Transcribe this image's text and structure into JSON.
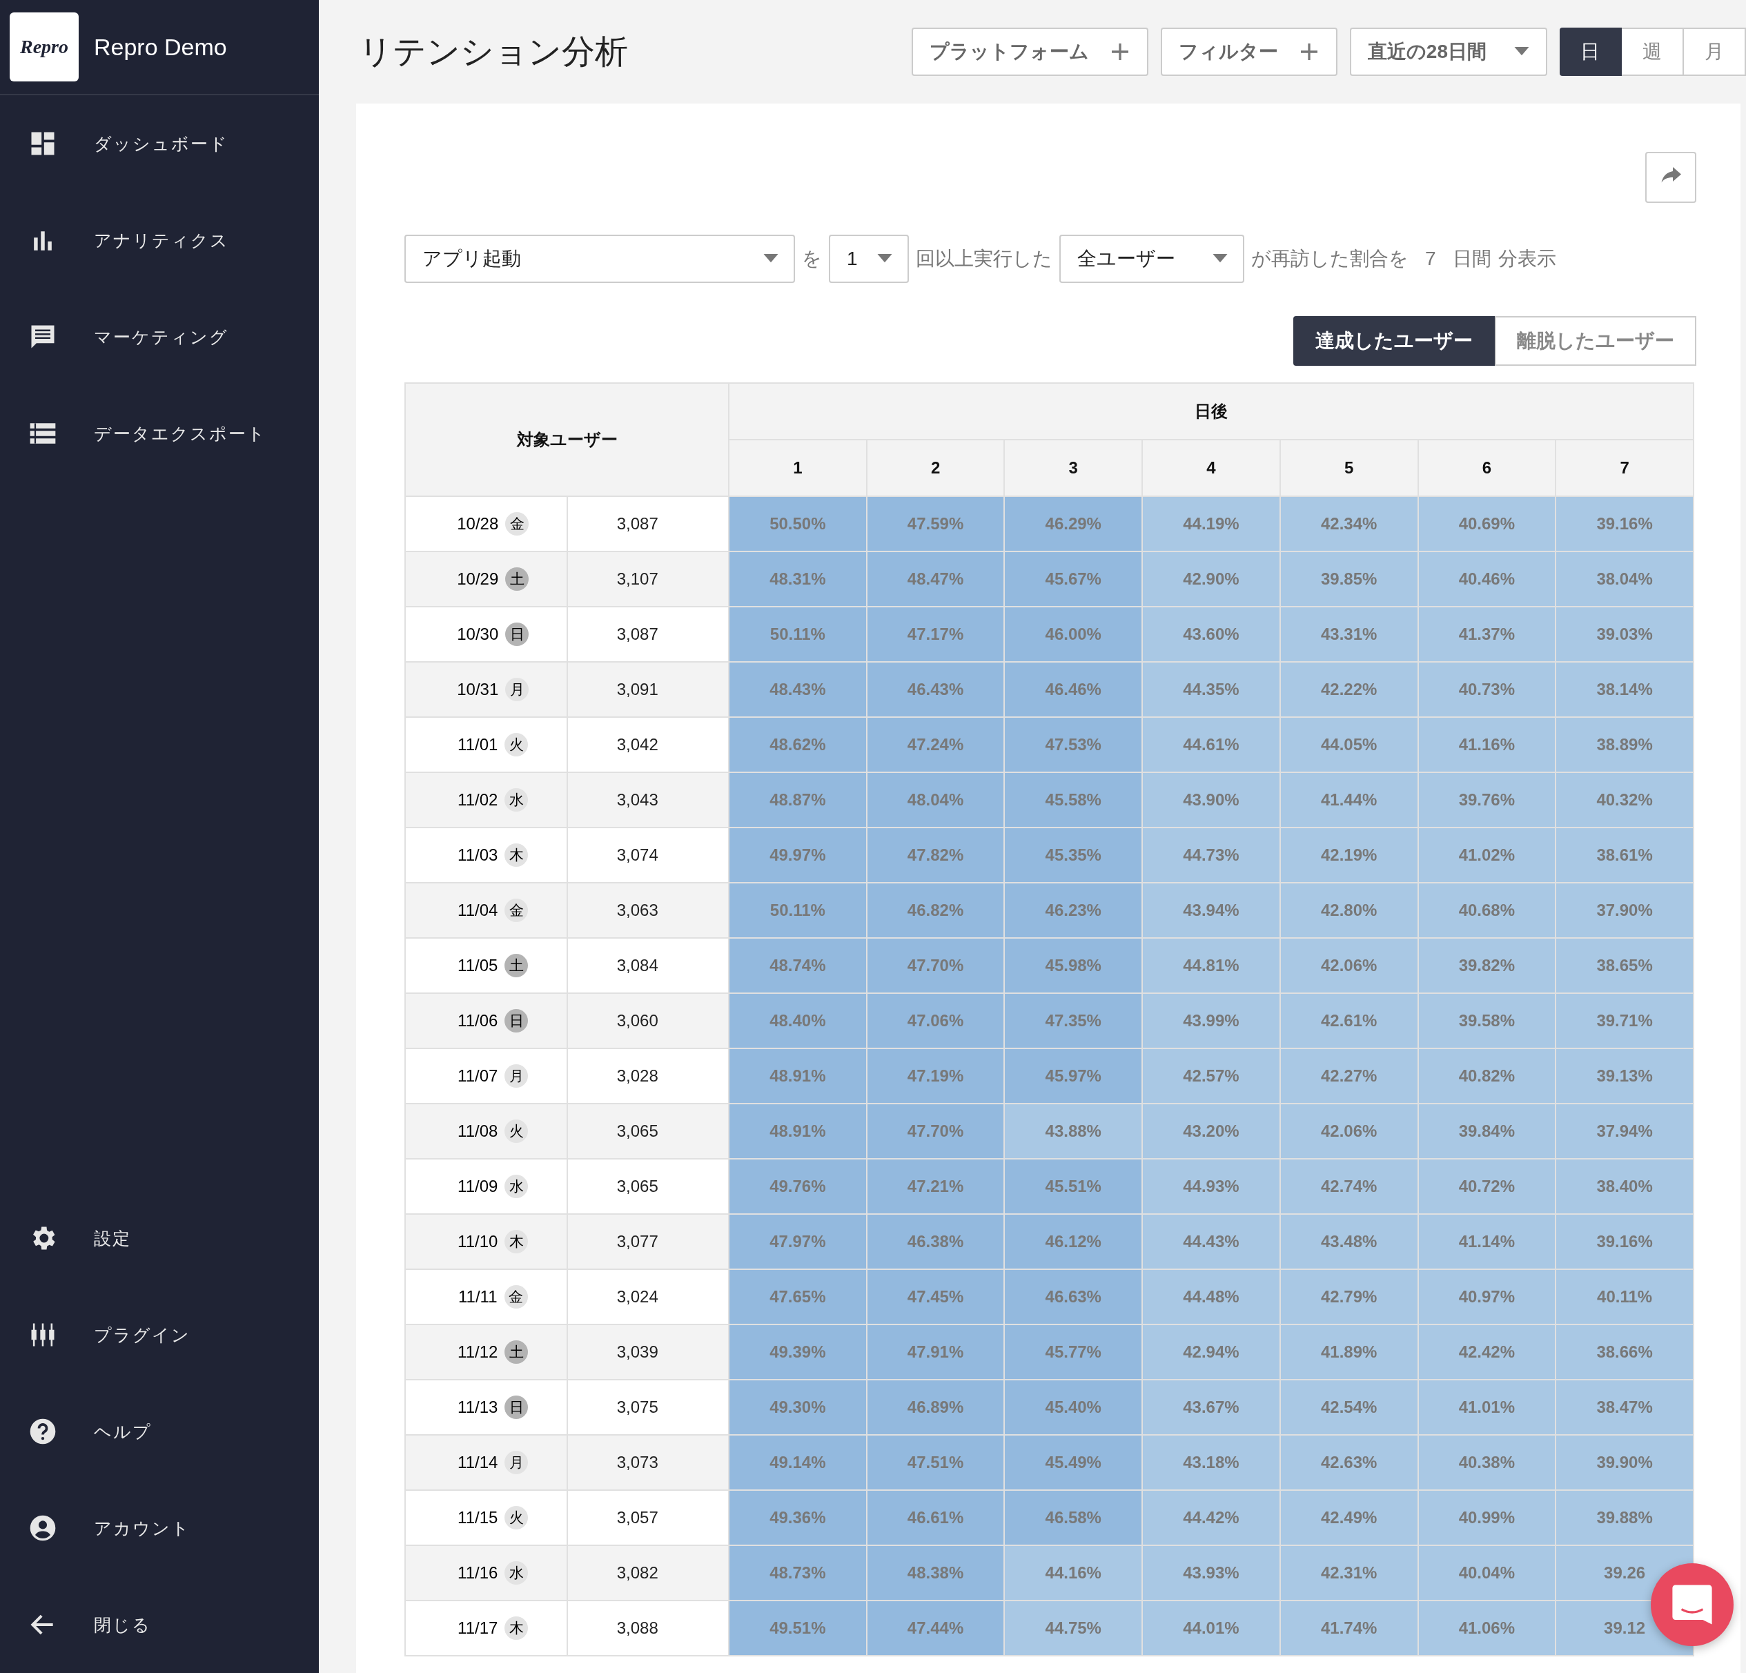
{
  "sidebar": {
    "brand_logo": "Repro",
    "app_name": "Repro Demo",
    "items": [
      {
        "kind": "dashboard",
        "label": "ダッシュボード"
      },
      {
        "kind": "analytics",
        "label": "アナリティクス"
      },
      {
        "kind": "marketing",
        "label": "マーケティング"
      },
      {
        "kind": "export",
        "label": "データエクスポート"
      }
    ],
    "bottom_items": [
      {
        "kind": "settings",
        "label": "設定"
      },
      {
        "kind": "plugin",
        "label": "プラグイン"
      },
      {
        "kind": "help",
        "label": "ヘルプ"
      },
      {
        "kind": "account",
        "label": "アカウント"
      },
      {
        "kind": "close",
        "label": "閉じる"
      }
    ]
  },
  "header": {
    "title": "リテンション分析",
    "platform_button": "プラットフォーム",
    "filter_button": "フィルター",
    "period": "直近の28日間",
    "granularity": [
      {
        "label": "日",
        "selected": true
      },
      {
        "label": "週",
        "selected": false
      },
      {
        "label": "月",
        "selected": false
      }
    ]
  },
  "query": {
    "event": "アプリ起動",
    "particle": "を",
    "count": "1",
    "text_1": "回以上実行した",
    "segment": "全ユーザー",
    "text_2": "が再訪した割合を",
    "days": "7",
    "text_3": "日間",
    "text_4": "分表示"
  },
  "user_toggle": [
    {
      "label": "達成したユーザー",
      "selected": true
    },
    {
      "label": "離脱したユーザー",
      "selected": false
    }
  ],
  "table": {
    "target_header": "対象ユーザー",
    "days_header": "日後",
    "day_columns": [
      "1",
      "2",
      "3",
      "4",
      "5",
      "6",
      "7"
    ],
    "rows": [
      {
        "date": "10/28",
        "weekday": "金",
        "weekend": false,
        "users": "3,087",
        "cells": [
          {
            "value": "50.50%",
            "color": "#93b9de"
          },
          {
            "value": "47.59%",
            "color": "#93b9de"
          },
          {
            "value": "46.29%",
            "color": "#93b9de"
          },
          {
            "value": "44.19%",
            "color": "#a9c8e4"
          },
          {
            "value": "42.34%",
            "color": "#a9c8e4"
          },
          {
            "value": "40.69%",
            "color": "#a9c8e4"
          },
          {
            "value": "39.16%",
            "color": "#a9c8e4"
          }
        ]
      },
      {
        "date": "10/29",
        "weekday": "土",
        "weekend": true,
        "users": "3,107",
        "cells": [
          {
            "value": "48.31%",
            "color": "#93b9de"
          },
          {
            "value": "48.47%",
            "color": "#93b9de"
          },
          {
            "value": "45.67%",
            "color": "#93b9de"
          },
          {
            "value": "42.90%",
            "color": "#a9c8e4"
          },
          {
            "value": "39.85%",
            "color": "#a9c8e4"
          },
          {
            "value": "40.46%",
            "color": "#a9c8e4"
          },
          {
            "value": "38.04%",
            "color": "#a9c8e4"
          }
        ]
      },
      {
        "date": "10/30",
        "weekday": "日",
        "weekend": true,
        "users": "3,087",
        "cells": [
          {
            "value": "50.11%",
            "color": "#93b9de"
          },
          {
            "value": "47.17%",
            "color": "#93b9de"
          },
          {
            "value": "46.00%",
            "color": "#93b9de"
          },
          {
            "value": "43.60%",
            "color": "#a9c8e4"
          },
          {
            "value": "43.31%",
            "color": "#a9c8e4"
          },
          {
            "value": "41.37%",
            "color": "#a9c8e4"
          },
          {
            "value": "39.03%",
            "color": "#a9c8e4"
          }
        ]
      },
      {
        "date": "10/31",
        "weekday": "月",
        "weekend": false,
        "users": "3,091",
        "cells": [
          {
            "value": "48.43%",
            "color": "#93b9de"
          },
          {
            "value": "46.43%",
            "color": "#93b9de"
          },
          {
            "value": "46.46%",
            "color": "#93b9de"
          },
          {
            "value": "44.35%",
            "color": "#a9c8e4"
          },
          {
            "value": "42.22%",
            "color": "#a9c8e4"
          },
          {
            "value": "40.73%",
            "color": "#a9c8e4"
          },
          {
            "value": "38.14%",
            "color": "#a9c8e4"
          }
        ]
      },
      {
        "date": "11/01",
        "weekday": "火",
        "weekend": false,
        "users": "3,042",
        "cells": [
          {
            "value": "48.62%",
            "color": "#93b9de"
          },
          {
            "value": "47.24%",
            "color": "#93b9de"
          },
          {
            "value": "47.53%",
            "color": "#93b9de"
          },
          {
            "value": "44.61%",
            "color": "#a9c8e4"
          },
          {
            "value": "44.05%",
            "color": "#a9c8e4"
          },
          {
            "value": "41.16%",
            "color": "#a9c8e4"
          },
          {
            "value": "38.89%",
            "color": "#a9c8e4"
          }
        ]
      },
      {
        "date": "11/02",
        "weekday": "水",
        "weekend": false,
        "users": "3,043",
        "cells": [
          {
            "value": "48.87%",
            "color": "#93b9de"
          },
          {
            "value": "48.04%",
            "color": "#93b9de"
          },
          {
            "value": "45.58%",
            "color": "#93b9de"
          },
          {
            "value": "43.90%",
            "color": "#a9c8e4"
          },
          {
            "value": "41.44%",
            "color": "#a9c8e4"
          },
          {
            "value": "39.76%",
            "color": "#a9c8e4"
          },
          {
            "value": "40.32%",
            "color": "#a9c8e4"
          }
        ]
      },
      {
        "date": "11/03",
        "weekday": "木",
        "weekend": false,
        "users": "3,074",
        "cells": [
          {
            "value": "49.97%",
            "color": "#93b9de"
          },
          {
            "value": "47.82%",
            "color": "#93b9de"
          },
          {
            "value": "45.35%",
            "color": "#93b9de"
          },
          {
            "value": "44.73%",
            "color": "#a9c8e4"
          },
          {
            "value": "42.19%",
            "color": "#a9c8e4"
          },
          {
            "value": "41.02%",
            "color": "#a9c8e4"
          },
          {
            "value": "38.61%",
            "color": "#a9c8e4"
          }
        ]
      },
      {
        "date": "11/04",
        "weekday": "金",
        "weekend": false,
        "users": "3,063",
        "cells": [
          {
            "value": "50.11%",
            "color": "#93b9de"
          },
          {
            "value": "46.82%",
            "color": "#93b9de"
          },
          {
            "value": "46.23%",
            "color": "#93b9de"
          },
          {
            "value": "43.94%",
            "color": "#a9c8e4"
          },
          {
            "value": "42.80%",
            "color": "#a9c8e4"
          },
          {
            "value": "40.68%",
            "color": "#a9c8e4"
          },
          {
            "value": "37.90%",
            "color": "#a9c8e4"
          }
        ]
      },
      {
        "date": "11/05",
        "weekday": "土",
        "weekend": true,
        "users": "3,084",
        "cells": [
          {
            "value": "48.74%",
            "color": "#93b9de"
          },
          {
            "value": "47.70%",
            "color": "#93b9de"
          },
          {
            "value": "45.98%",
            "color": "#93b9de"
          },
          {
            "value": "44.81%",
            "color": "#a9c8e4"
          },
          {
            "value": "42.06%",
            "color": "#a9c8e4"
          },
          {
            "value": "39.82%",
            "color": "#a9c8e4"
          },
          {
            "value": "38.65%",
            "color": "#a9c8e4"
          }
        ]
      },
      {
        "date": "11/06",
        "weekday": "日",
        "weekend": true,
        "users": "3,060",
        "cells": [
          {
            "value": "48.40%",
            "color": "#93b9de"
          },
          {
            "value": "47.06%",
            "color": "#93b9de"
          },
          {
            "value": "47.35%",
            "color": "#93b9de"
          },
          {
            "value": "43.99%",
            "color": "#a9c8e4"
          },
          {
            "value": "42.61%",
            "color": "#a9c8e4"
          },
          {
            "value": "39.58%",
            "color": "#a9c8e4"
          },
          {
            "value": "39.71%",
            "color": "#a9c8e4"
          }
        ]
      },
      {
        "date": "11/07",
        "weekday": "月",
        "weekend": false,
        "users": "3,028",
        "cells": [
          {
            "value": "48.91%",
            "color": "#93b9de"
          },
          {
            "value": "47.19%",
            "color": "#93b9de"
          },
          {
            "value": "45.97%",
            "color": "#93b9de"
          },
          {
            "value": "42.57%",
            "color": "#a9c8e4"
          },
          {
            "value": "42.27%",
            "color": "#a9c8e4"
          },
          {
            "value": "40.82%",
            "color": "#a9c8e4"
          },
          {
            "value": "39.13%",
            "color": "#a9c8e4"
          }
        ]
      },
      {
        "date": "11/08",
        "weekday": "火",
        "weekend": false,
        "users": "3,065",
        "cells": [
          {
            "value": "48.91%",
            "color": "#93b9de"
          },
          {
            "value": "47.70%",
            "color": "#93b9de"
          },
          {
            "value": "43.88%",
            "color": "#a9c8e4"
          },
          {
            "value": "43.20%",
            "color": "#a9c8e4"
          },
          {
            "value": "42.06%",
            "color": "#a9c8e4"
          },
          {
            "value": "39.84%",
            "color": "#a9c8e4"
          },
          {
            "value": "37.94%",
            "color": "#a9c8e4"
          }
        ]
      },
      {
        "date": "11/09",
        "weekday": "水",
        "weekend": false,
        "users": "3,065",
        "cells": [
          {
            "value": "49.76%",
            "color": "#93b9de"
          },
          {
            "value": "47.21%",
            "color": "#93b9de"
          },
          {
            "value": "45.51%",
            "color": "#93b9de"
          },
          {
            "value": "44.93%",
            "color": "#a9c8e4"
          },
          {
            "value": "42.74%",
            "color": "#a9c8e4"
          },
          {
            "value": "40.72%",
            "color": "#a9c8e4"
          },
          {
            "value": "38.40%",
            "color": "#a9c8e4"
          }
        ]
      },
      {
        "date": "11/10",
        "weekday": "木",
        "weekend": false,
        "users": "3,077",
        "cells": [
          {
            "value": "47.97%",
            "color": "#93b9de"
          },
          {
            "value": "46.38%",
            "color": "#93b9de"
          },
          {
            "value": "46.12%",
            "color": "#93b9de"
          },
          {
            "value": "44.43%",
            "color": "#a9c8e4"
          },
          {
            "value": "43.48%",
            "color": "#a9c8e4"
          },
          {
            "value": "41.14%",
            "color": "#a9c8e4"
          },
          {
            "value": "39.16%",
            "color": "#a9c8e4"
          }
        ]
      },
      {
        "date": "11/11",
        "weekday": "金",
        "weekend": false,
        "users": "3,024",
        "cells": [
          {
            "value": "47.65%",
            "color": "#93b9de"
          },
          {
            "value": "47.45%",
            "color": "#93b9de"
          },
          {
            "value": "46.63%",
            "color": "#93b9de"
          },
          {
            "value": "44.48%",
            "color": "#a9c8e4"
          },
          {
            "value": "42.79%",
            "color": "#a9c8e4"
          },
          {
            "value": "40.97%",
            "color": "#a9c8e4"
          },
          {
            "value": "40.11%",
            "color": "#a9c8e4"
          }
        ]
      },
      {
        "date": "11/12",
        "weekday": "土",
        "weekend": true,
        "users": "3,039",
        "cells": [
          {
            "value": "49.39%",
            "color": "#93b9de"
          },
          {
            "value": "47.91%",
            "color": "#93b9de"
          },
          {
            "value": "45.77%",
            "color": "#93b9de"
          },
          {
            "value": "42.94%",
            "color": "#a9c8e4"
          },
          {
            "value": "41.89%",
            "color": "#a9c8e4"
          },
          {
            "value": "42.42%",
            "color": "#a9c8e4"
          },
          {
            "value": "38.66%",
            "color": "#a9c8e4"
          }
        ]
      },
      {
        "date": "11/13",
        "weekday": "日",
        "weekend": true,
        "users": "3,075",
        "cells": [
          {
            "value": "49.30%",
            "color": "#93b9de"
          },
          {
            "value": "46.89%",
            "color": "#93b9de"
          },
          {
            "value": "45.40%",
            "color": "#93b9de"
          },
          {
            "value": "43.67%",
            "color": "#a9c8e4"
          },
          {
            "value": "42.54%",
            "color": "#a9c8e4"
          },
          {
            "value": "41.01%",
            "color": "#a9c8e4"
          },
          {
            "value": "38.47%",
            "color": "#a9c8e4"
          }
        ]
      },
      {
        "date": "11/14",
        "weekday": "月",
        "weekend": false,
        "users": "3,073",
        "cells": [
          {
            "value": "49.14%",
            "color": "#93b9de"
          },
          {
            "value": "47.51%",
            "color": "#93b9de"
          },
          {
            "value": "45.49%",
            "color": "#93b9de"
          },
          {
            "value": "43.18%",
            "color": "#a9c8e4"
          },
          {
            "value": "42.63%",
            "color": "#a9c8e4"
          },
          {
            "value": "40.38%",
            "color": "#a9c8e4"
          },
          {
            "value": "39.90%",
            "color": "#a9c8e4"
          }
        ]
      },
      {
        "date": "11/15",
        "weekday": "火",
        "weekend": false,
        "users": "3,057",
        "cells": [
          {
            "value": "49.36%",
            "color": "#93b9de"
          },
          {
            "value": "46.61%",
            "color": "#93b9de"
          },
          {
            "value": "46.58%",
            "color": "#93b9de"
          },
          {
            "value": "44.42%",
            "color": "#a9c8e4"
          },
          {
            "value": "42.49%",
            "color": "#a9c8e4"
          },
          {
            "value": "40.99%",
            "color": "#a9c8e4"
          },
          {
            "value": "39.88%",
            "color": "#a9c8e4"
          }
        ]
      },
      {
        "date": "11/16",
        "weekday": "水",
        "weekend": false,
        "users": "3,082",
        "cells": [
          {
            "value": "48.73%",
            "color": "#93b9de"
          },
          {
            "value": "48.38%",
            "color": "#93b9de"
          },
          {
            "value": "44.16%",
            "color": "#a9c8e4"
          },
          {
            "value": "43.93%",
            "color": "#a9c8e4"
          },
          {
            "value": "42.31%",
            "color": "#a9c8e4"
          },
          {
            "value": "40.04%",
            "color": "#a9c8e4"
          },
          {
            "value": "39.26",
            "color": "#a9c8e4"
          }
        ]
      },
      {
        "date": "11/17",
        "weekday": "木",
        "weekend": false,
        "users": "3,088",
        "cells": [
          {
            "value": "49.51%",
            "color": "#93b9de"
          },
          {
            "value": "47.44%",
            "color": "#93b9de"
          },
          {
            "value": "44.75%",
            "color": "#a9c8e4"
          },
          {
            "value": "44.01%",
            "color": "#a9c8e4"
          },
          {
            "value": "41.74%",
            "color": "#a9c8e4"
          },
          {
            "value": "41.06%",
            "color": "#a9c8e4"
          },
          {
            "value": "39.12",
            "color": "#a9c8e4"
          }
        ]
      }
    ]
  }
}
